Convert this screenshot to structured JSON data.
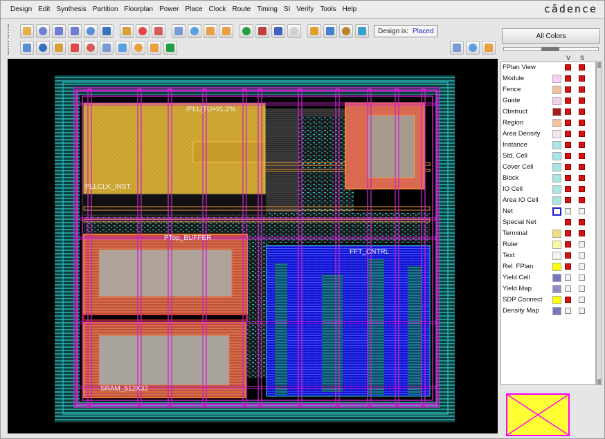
{
  "brand": "cādence",
  "menus": [
    "Design",
    "Edit",
    "Synthesis",
    "Partition",
    "Floorplan",
    "Power",
    "Place",
    "Clock",
    "Route",
    "Timing",
    "SI",
    "Verify",
    "Tools",
    "Help"
  ],
  "toolbar": {
    "row1_icons": [
      "open-folder",
      "zoom-in",
      "zoom-out",
      "zoom-area",
      "zoom-fit",
      "zoom-select",
      "redraw",
      "color-highlight",
      "color-picker",
      "ruler",
      "select",
      "undo",
      "redo",
      "green-ball",
      "bird-view",
      "info",
      "window",
      "report",
      "move",
      "wire-edit",
      "cross-probe"
    ],
    "row2_icons": [
      "pointer",
      "pan",
      "edit-wire",
      "add-block",
      "add-pin",
      "split",
      "merge",
      "cut",
      "stretch",
      "align"
    ],
    "row2_right_icons": [
      "fplan-view",
      "amoeba-view",
      "physical-view"
    ],
    "design_label": "Design is:",
    "design_status": "Placed"
  },
  "layout": {
    "labels": {
      "pll": "/PLL(TU=91.2%",
      "clk": "PLLCLK_INST",
      "blockA": "PTop_BUFFER",
      "blockB": "FFT_CNTRL",
      "blockC": "SRAM_512X32"
    }
  },
  "panel": {
    "all_colors_label": "All Colors",
    "col_v": "V",
    "col_s": "S",
    "layers": [
      {
        "name": "FPlan View",
        "swatch": "",
        "v": true,
        "s": true
      },
      {
        "name": "Module",
        "swatch": "#f6d0f2",
        "v": true,
        "s": true
      },
      {
        "name": "Fence",
        "swatch": "#f5c19d",
        "v": true,
        "s": true
      },
      {
        "name": "Guide",
        "swatch": "#f1d3ee",
        "v": true,
        "s": true
      },
      {
        "name": "Obstruct",
        "swatch": "#a71b1b",
        "v": true,
        "s": true
      },
      {
        "name": "Region",
        "swatch": "#f5c2a0",
        "v": true,
        "s": true
      },
      {
        "name": "Area Density",
        "swatch": "#f3e6f3",
        "v": true,
        "s": true
      },
      {
        "name": "Instance",
        "swatch": "#a9e5e5",
        "v": true,
        "s": true
      },
      {
        "name": "Std. Cell",
        "swatch": "#a9e5e5",
        "v": true,
        "s": true
      },
      {
        "name": "Cover Cell",
        "swatch": "#a9e5e5",
        "v": true,
        "s": true
      },
      {
        "name": "Block",
        "swatch": "#a9e5e5",
        "v": true,
        "s": true
      },
      {
        "name": "IO Cell",
        "swatch": "#a9e5e5",
        "v": true,
        "s": true
      },
      {
        "name": "Area IO Cell",
        "swatch": "#a9e5e5",
        "v": true,
        "s": true
      },
      {
        "name": "Net",
        "swatch": "#ffffff",
        "swatch_border": "#1a1ad6",
        "v": false,
        "s": false
      },
      {
        "name": "Special Net",
        "swatch": "",
        "v": true,
        "s": true
      },
      {
        "name": "Terminal",
        "swatch": "#f0dc82",
        "v": true,
        "s": true
      },
      {
        "name": "Ruler",
        "swatch": "#fbf7a2",
        "v": true,
        "s": false
      },
      {
        "name": "Text",
        "swatch": "#f2f2f2",
        "v": true,
        "s": false
      },
      {
        "name": "Rel. FPlan",
        "swatch": "#ffff00",
        "v": true,
        "s": false
      },
      {
        "name": "Yield Cell",
        "swatch": "#7777c0",
        "v": false,
        "s": false
      },
      {
        "name": "Yield Map",
        "swatch": "#8e8ec9",
        "v": false,
        "s": false
      },
      {
        "name": "SDP Connect",
        "swatch": "#ffff00",
        "v": true,
        "s": false
      },
      {
        "name": "Density Map",
        "swatch": "#7777c0",
        "v": false,
        "s": false
      }
    ]
  },
  "colors": {
    "canvas_bg": "#000000",
    "pad_ring": "#1ba9a9",
    "power_stripe": "#cc22cc",
    "pll_block": "#c8a02a",
    "macro_border": "#f07a2a",
    "macro_fill": "#b0a39a",
    "stdcell_blue": "#1010e0",
    "stdcell_teal": "#1aa0a0"
  }
}
